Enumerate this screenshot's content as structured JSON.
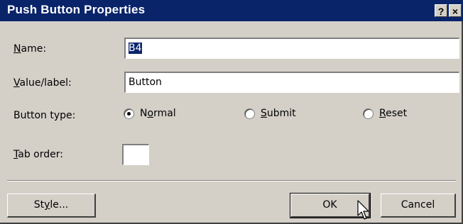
{
  "window": {
    "title": "Push Button Properties",
    "help_label": "?",
    "close_label": "×"
  },
  "fields": {
    "name_label_prefix": "",
    "name_label_underline": "N",
    "name_label_rest": "ame:",
    "name_value": "B4",
    "value_label_underline": "V",
    "value_label_rest": "alue/label:",
    "value_value": "Button",
    "button_type_label": "Button type:",
    "tab_order_label_underline": "T",
    "tab_order_label_rest": "ab order:",
    "tab_order_value": ""
  },
  "radios": {
    "normal_prefix": "N",
    "normal_underline": "o",
    "normal_rest": "rmal",
    "submit_underline": "S",
    "submit_rest": "ubmit",
    "reset_underline": "R",
    "reset_rest": "eset",
    "selected": "Normal"
  },
  "buttons": {
    "style_prefix": "St",
    "style_underline": "y",
    "style_rest": "le...",
    "ok_label": "OK",
    "cancel_label": "Cancel"
  },
  "colors": {
    "titlebar": "#0a246a",
    "dialog_bg": "#d4d0c8",
    "selection": "#0a246a"
  }
}
